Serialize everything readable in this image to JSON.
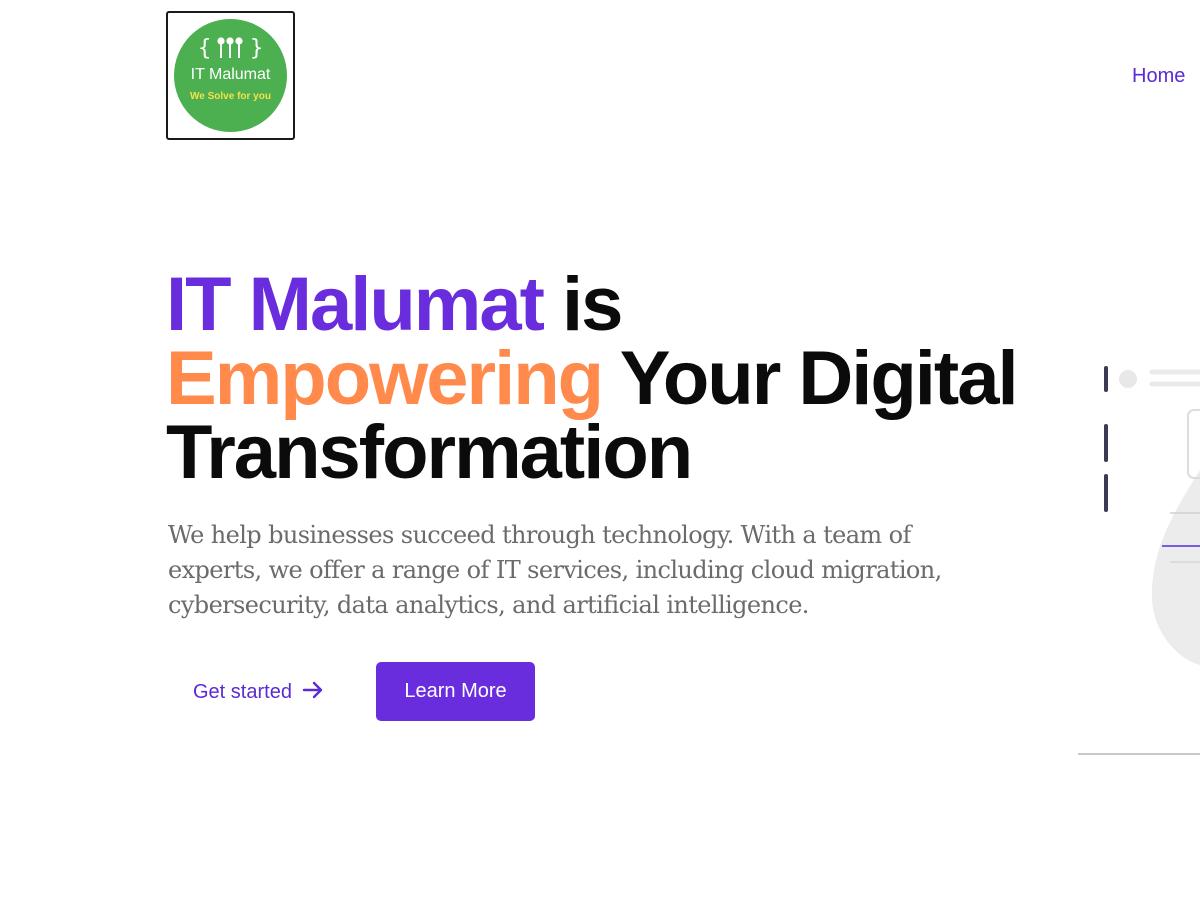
{
  "logo": {
    "symbol": "{ ⫯⫯⫯ }",
    "name": "IT Malumat",
    "tagline": "We Solve for you",
    "bg_color": "#4caf50",
    "tagline_color": "#f6e04b"
  },
  "nav": {
    "home_label": "Home"
  },
  "hero": {
    "title_part1": "IT Malumat",
    "title_part2": " is ",
    "title_part3": "Empowering",
    "title_part4": " Your Digital Transformation",
    "description": "We help businesses succeed through technology. With a team of experts, we offer a range of IT services, including cloud migration, cybersecurity, data analytics, and artificial intelligence.",
    "get_started_label": "Get started",
    "get_started_icon": "arrow-right-icon",
    "learn_more_label": "Learn More"
  },
  "colors": {
    "accent_purple": "#6a2ddd",
    "accent_orange": "#ff8a4c",
    "text_dark": "#0b0b0b",
    "text_muted": "#6b6b6b"
  }
}
